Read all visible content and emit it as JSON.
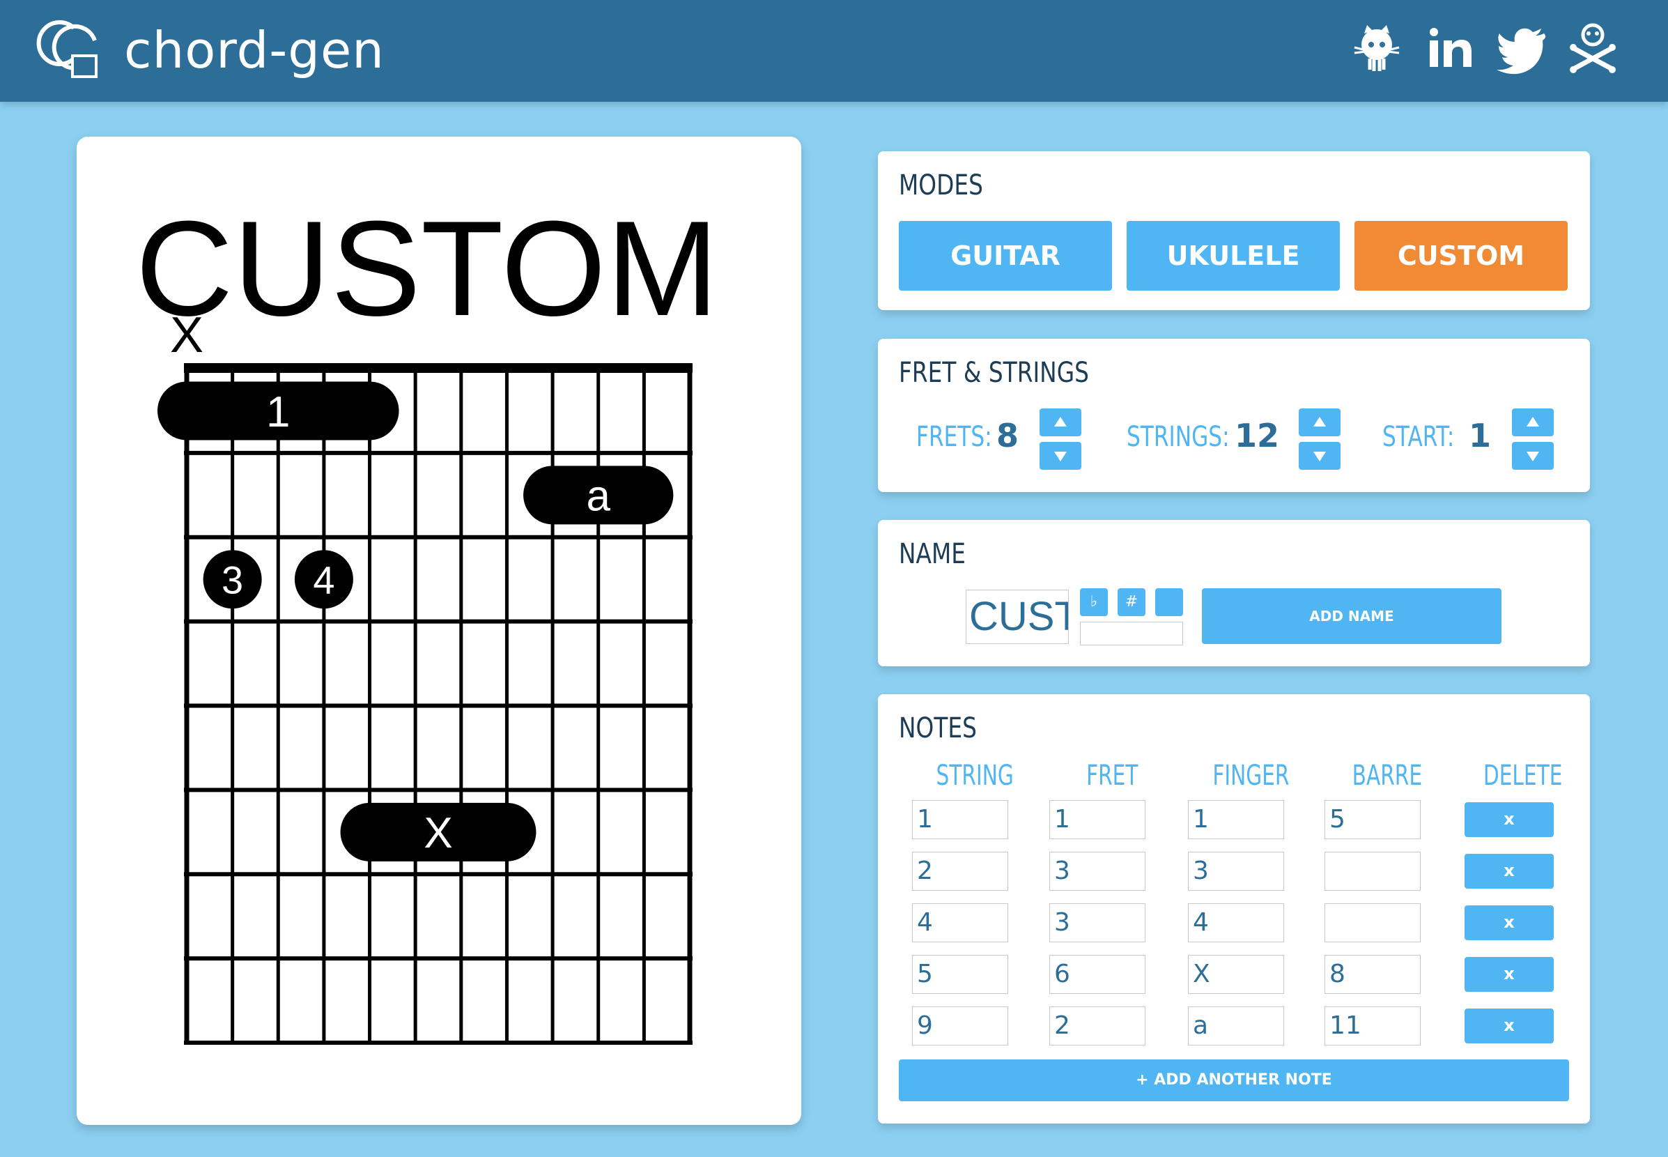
{
  "header": {
    "app_title": "chord-gen",
    "logo_icon": "chord-gen-logo",
    "social_icons": [
      "github-icon",
      "linkedin-icon",
      "twitter-icon",
      "skull-crossbones-icon"
    ]
  },
  "colors": {
    "background": "#8ccff1",
    "header": "#2d6e98",
    "accent": "#4fb6f3",
    "active_mode": "#f08a34",
    "text_dark": "#1d3c55"
  },
  "diagram": {
    "title": "CUSTOM",
    "frets": 8,
    "strings": 12,
    "start": 1,
    "open_marks": [
      {
        "string": 1,
        "text": "X"
      }
    ],
    "markers": [
      {
        "string_from": 1,
        "string_to": 5,
        "fret": 1,
        "text": "1"
      },
      {
        "string_from": 9,
        "string_to": 11,
        "fret": 2,
        "text": "a"
      },
      {
        "string_from": 2,
        "string_to": 2,
        "fret": 3,
        "text": "3"
      },
      {
        "string_from": 4,
        "string_to": 4,
        "fret": 3,
        "text": "4"
      },
      {
        "string_from": 5,
        "string_to": 8,
        "fret": 6,
        "text": "X"
      }
    ]
  },
  "modes": {
    "title": "MODES",
    "buttons": [
      "GUITAR",
      "UKULELE",
      "CUSTOM"
    ],
    "active": "CUSTOM"
  },
  "fret_strings": {
    "title": "FRET & STRINGS",
    "frets_label": "FRETS:",
    "frets_value": "8",
    "strings_label": "STRINGS:",
    "strings_value": "12",
    "start_label": "START:",
    "start_value": "1"
  },
  "name_panel": {
    "title": "NAME",
    "name_value": "CUSTOM",
    "flat_symbol": "♭",
    "sharp_symbol": "#",
    "third_symbol": "",
    "add_name_label": "ADD NAME"
  },
  "notes": {
    "title": "NOTES",
    "headers": [
      "STRING",
      "FRET",
      "FINGER",
      "BARRE",
      "DELETE"
    ],
    "rows": [
      {
        "string": "1",
        "fret": "1",
        "finger": "1",
        "barre": "5"
      },
      {
        "string": "2",
        "fret": "3",
        "finger": "3",
        "barre": ""
      },
      {
        "string": "4",
        "fret": "3",
        "finger": "4",
        "barre": ""
      },
      {
        "string": "5",
        "fret": "6",
        "finger": "X",
        "barre": "8"
      },
      {
        "string": "9",
        "fret": "2",
        "finger": "a",
        "barre": "11"
      }
    ],
    "delete_label": "x",
    "add_note_label": "+ ADD ANOTHER NOTE"
  }
}
